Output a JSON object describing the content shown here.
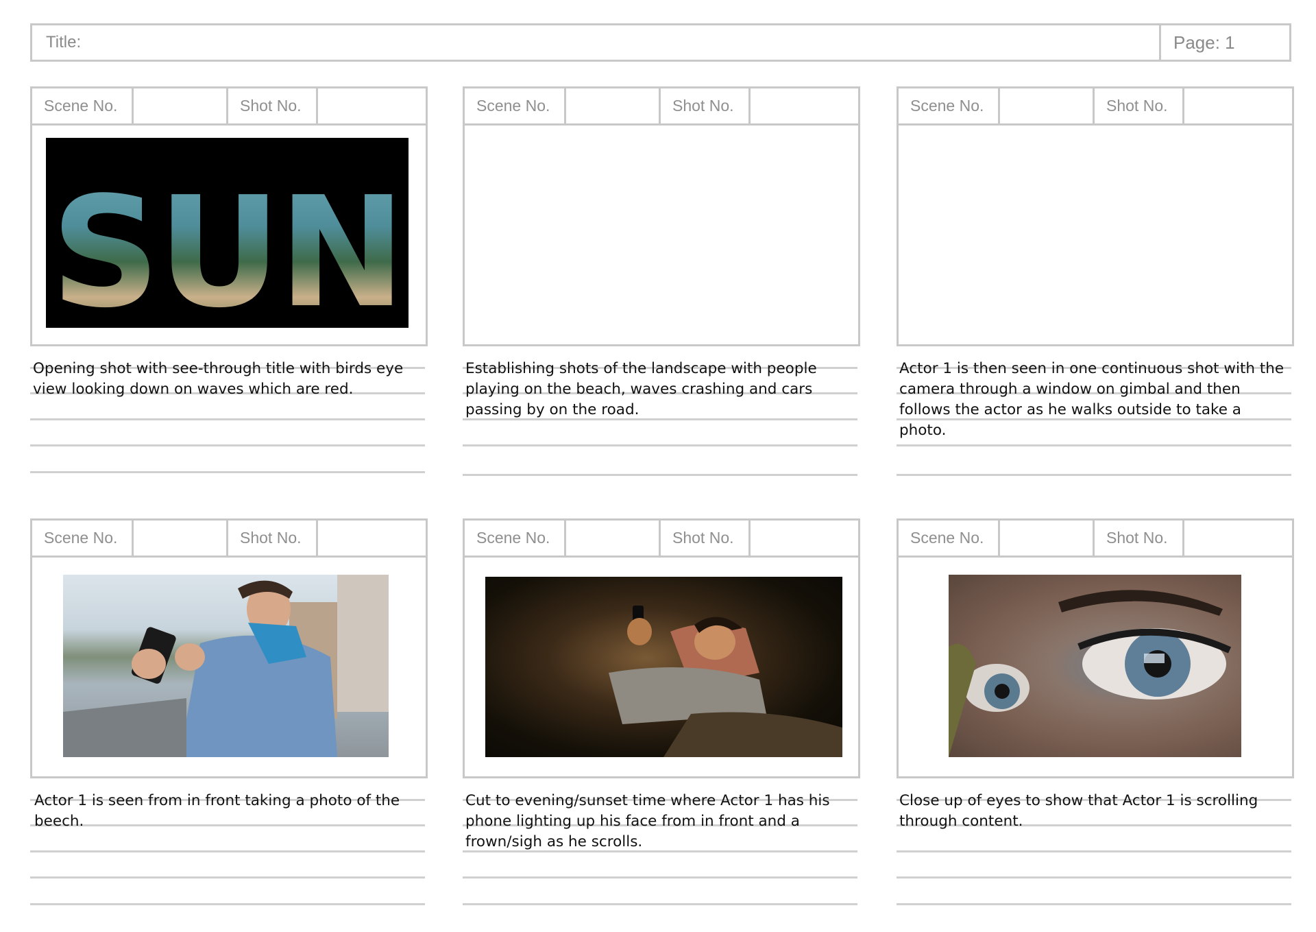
{
  "header": {
    "title_label": "Title:",
    "page_label": "Page: 1"
  },
  "panels": [
    {
      "scene_label": "Scene No.",
      "shot_label": "Shot No.",
      "image": "sun-title-beach-image",
      "image_text": "SUN",
      "description": "Opening shot with see-through title with birds eye view looking down on waves which are red."
    },
    {
      "scene_label": "Scene No.",
      "shot_label": "Shot No.",
      "image": "",
      "description": "Establishing shots of the landscape with people playing on the beach, waves crashing and cars passing by on the road."
    },
    {
      "scene_label": "Scene No.",
      "shot_label": "Shot No.",
      "image": "",
      "description": "Actor 1 is then seen in one continuous shot with the camera through a window on gimbal and then follows the actor as he walks outside to take a photo."
    },
    {
      "scene_label": "Scene No.",
      "shot_label": "Shot No.",
      "image": "man-taking-phone-photo-image",
      "description": "Actor 1 is seen from in front taking a photo of the beech."
    },
    {
      "scene_label": "Scene No.",
      "shot_label": "Shot No.",
      "image": "man-on-sofa-with-phone-image",
      "description": "Cut to evening/sunset time where Actor 1 has his phone lighting up his face from in front and a frown/sigh as he scrolls."
    },
    {
      "scene_label": "Scene No.",
      "shot_label": "Shot No.",
      "image": "eyes-closeup-image",
      "description": "Close up of eyes to show that Actor 1  is scrolling through content."
    }
  ]
}
